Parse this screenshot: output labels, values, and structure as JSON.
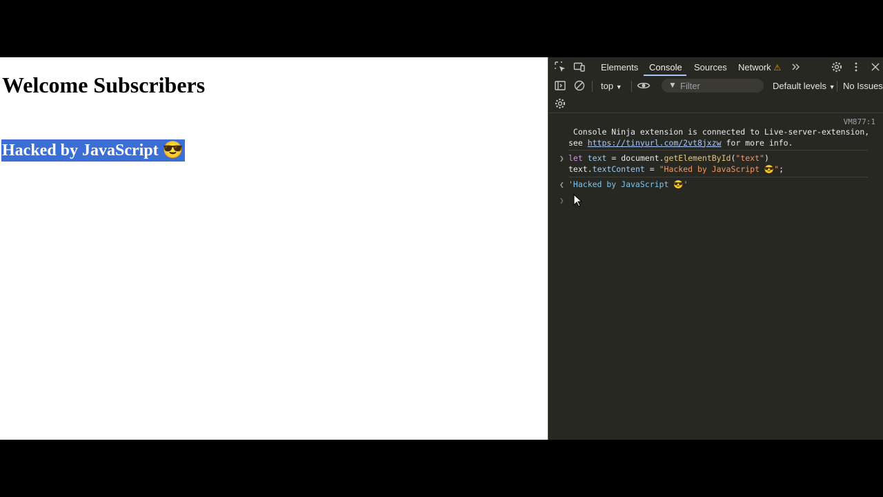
{
  "page": {
    "heading": "Welcome Subscribers",
    "hacked_text": "Hacked by JavaScript 😎"
  },
  "devtools": {
    "tabs": {
      "elements": "Elements",
      "console": "Console",
      "sources": "Sources",
      "network": "Network"
    },
    "toolbar": {
      "context": "top",
      "filter_placeholder": "Filter",
      "levels": "Default levels",
      "issues": "No Issues"
    },
    "console": {
      "source_link": "VM877:1",
      "ninja_line1": " Console Ninja extension is connected to Live-server-extension,",
      "ninja_see": "see ",
      "ninja_url": "https://tinyurl.com/2vt8jxzw",
      "ninja_tail": " for more info.",
      "code_let": "let",
      "code_text": "text",
      "code_eq1": " = document.",
      "code_fn": "getElementById",
      "code_open": "(",
      "code_arg": "\"text\"",
      "code_close": ")",
      "code2_text": "text",
      "code2_dot": ".",
      "code2_prop": "textContent",
      "code2_eq": " = ",
      "code2_str": "\"Hacked by JavaScript 😎\"",
      "code2_end": ";",
      "result": "'Hacked by JavaScript 😎'"
    },
    "colors": {
      "panel_bg": "#282822",
      "accent": "#a8c7fa",
      "selection": "#3b6fd6",
      "warning": "#f29900"
    },
    "icons": [
      "inspect-icon",
      "device-toolbar-icon",
      "more-tabs-icon",
      "settings-icon",
      "kebab-menu-icon",
      "close-icon",
      "sidebar-icon",
      "clear-console-icon",
      "eye-icon",
      "filter-icon",
      "console-settings-icon"
    ]
  }
}
